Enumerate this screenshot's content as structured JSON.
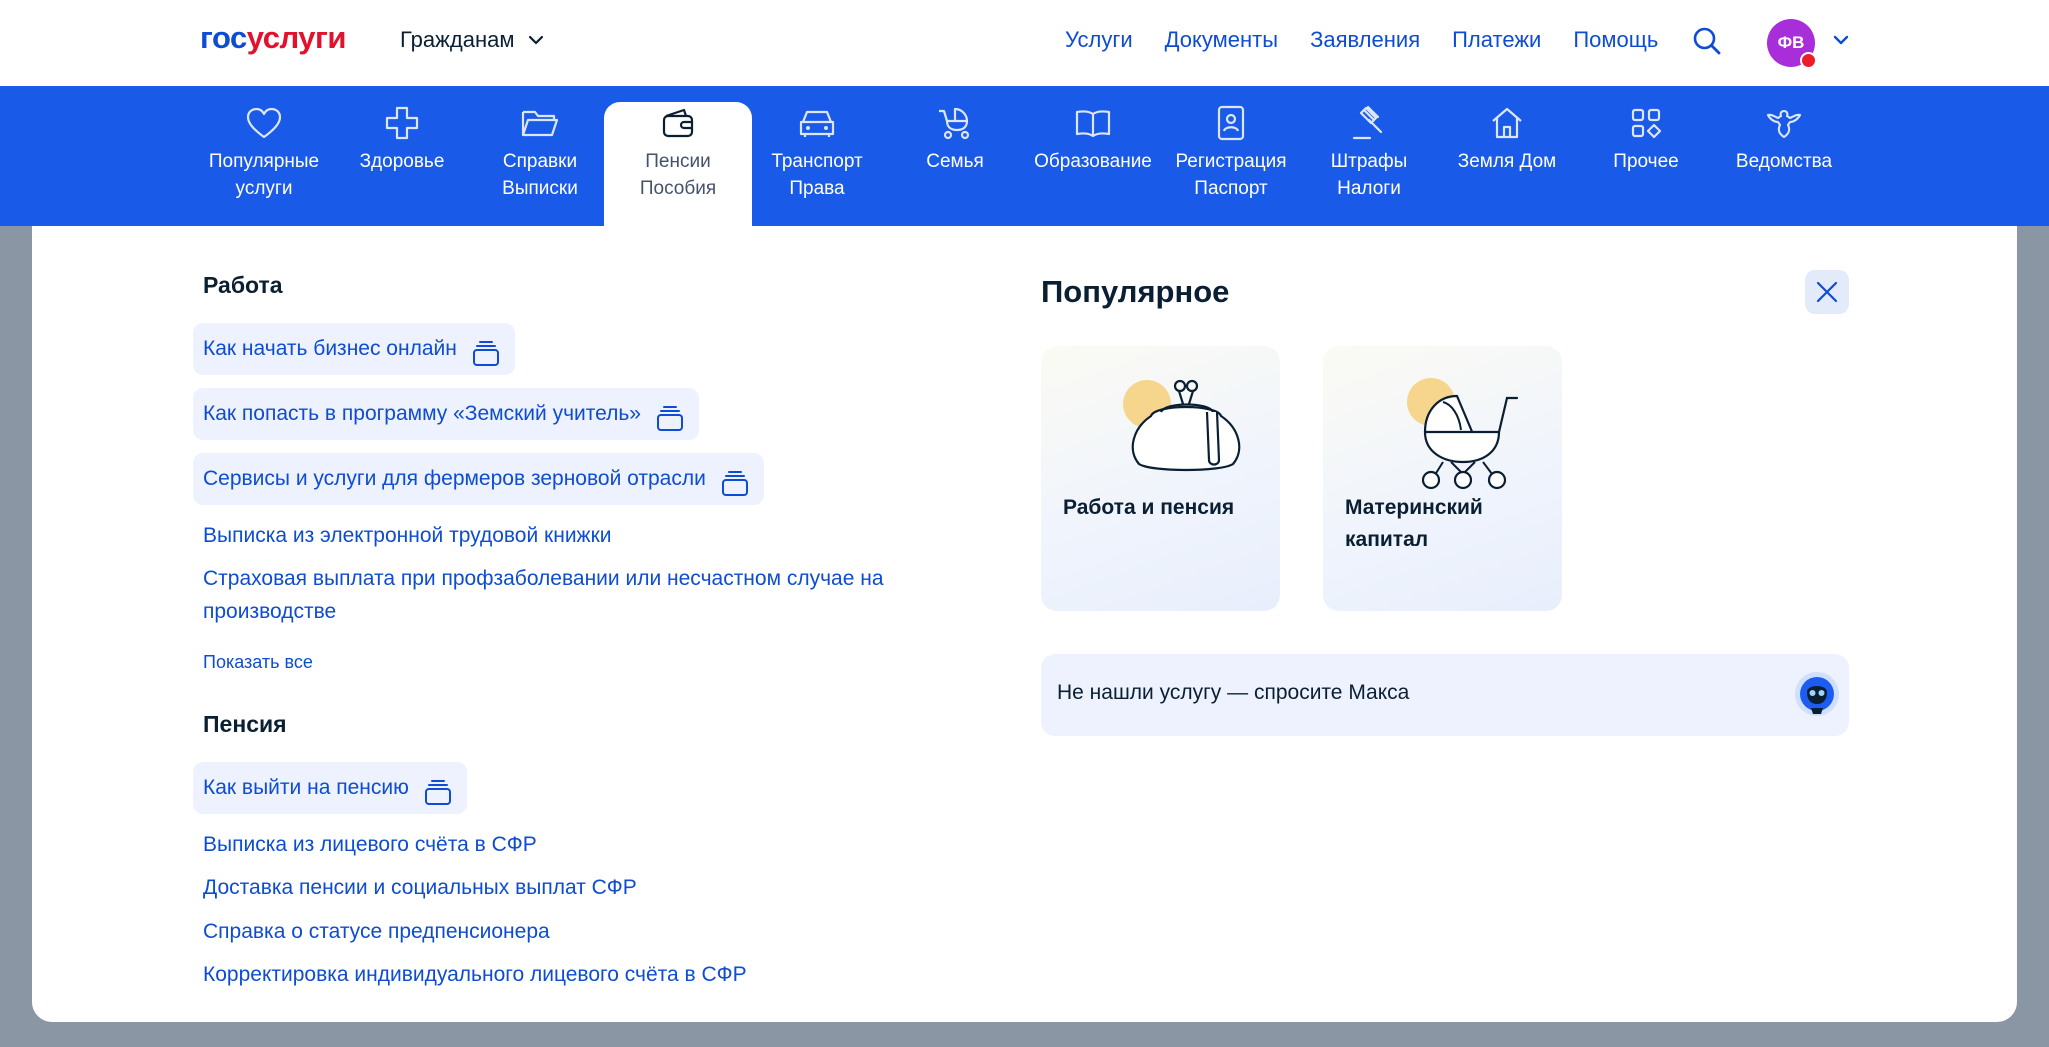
{
  "header": {
    "logo_part1": "гос",
    "logo_part2": "услуги",
    "audience": "Гражданам",
    "nav": [
      "Услуги",
      "Документы",
      "Заявления",
      "Платежи",
      "Помощь"
    ],
    "avatar_initials": "ФВ"
  },
  "categories": [
    {
      "l1": "Популярные",
      "l2": "услуги",
      "icon": "heart-icon"
    },
    {
      "l1": "Здоровье",
      "l2": "",
      "icon": "medical-cross-icon"
    },
    {
      "l1": "Справки",
      "l2": "Выписки",
      "icon": "folder-icon"
    },
    {
      "l1": "Пенсии",
      "l2": "Пособия",
      "icon": "wallet-icon",
      "active": true
    },
    {
      "l1": "Транспорт",
      "l2": "Права",
      "icon": "car-icon"
    },
    {
      "l1": "Семья",
      "l2": "",
      "icon": "stroller-icon"
    },
    {
      "l1": "Образование",
      "l2": "",
      "icon": "book-icon"
    },
    {
      "l1": "Регистрация",
      "l2": "Паспорт",
      "icon": "id-card-icon"
    },
    {
      "l1": "Штрафы",
      "l2": "Налоги",
      "icon": "gavel-icon"
    },
    {
      "l1": "Земля Дом",
      "l2": "",
      "icon": "house-icon"
    },
    {
      "l1": "Прочее",
      "l2": "",
      "icon": "grid-icon"
    },
    {
      "l1": "Ведомства",
      "l2": "",
      "icon": "emblem-icon"
    }
  ],
  "work": {
    "title": "Работа",
    "links": [
      "Как начать бизнес онлайн",
      "Как попасть в программу «Земский учитель»",
      "Сервисы и услуги для фермеров зерновой отрасли",
      "Выписка из электронной трудовой книжки",
      "Страховая выплата при профзаболевании или несчастном случае на",
      "производстве"
    ],
    "show_all": "Показать все"
  },
  "pension": {
    "title": "Пенсия",
    "links": [
      "Как выйти на пенсию",
      "Выписка из лицевого счёта в СФР",
      "Доставка пенсии и социальных выплат СФР",
      "Справка о статусе предпенсионера",
      "Корректировка индивидуального лицевого счёта в СФР"
    ]
  },
  "popular": {
    "title": "Популярное",
    "cards": [
      {
        "l1": "Работа и пенсия",
        "l2": ""
      },
      {
        "l1": "Материнский",
        "l2": "капитал"
      }
    ],
    "ask": "Не нашли услугу — спросите Макса"
  },
  "colors": {
    "accent": "#0d4cd3",
    "catbar": "#1a5ae8",
    "chip": "#edf2fe",
    "logo_red": "#e2122e"
  }
}
